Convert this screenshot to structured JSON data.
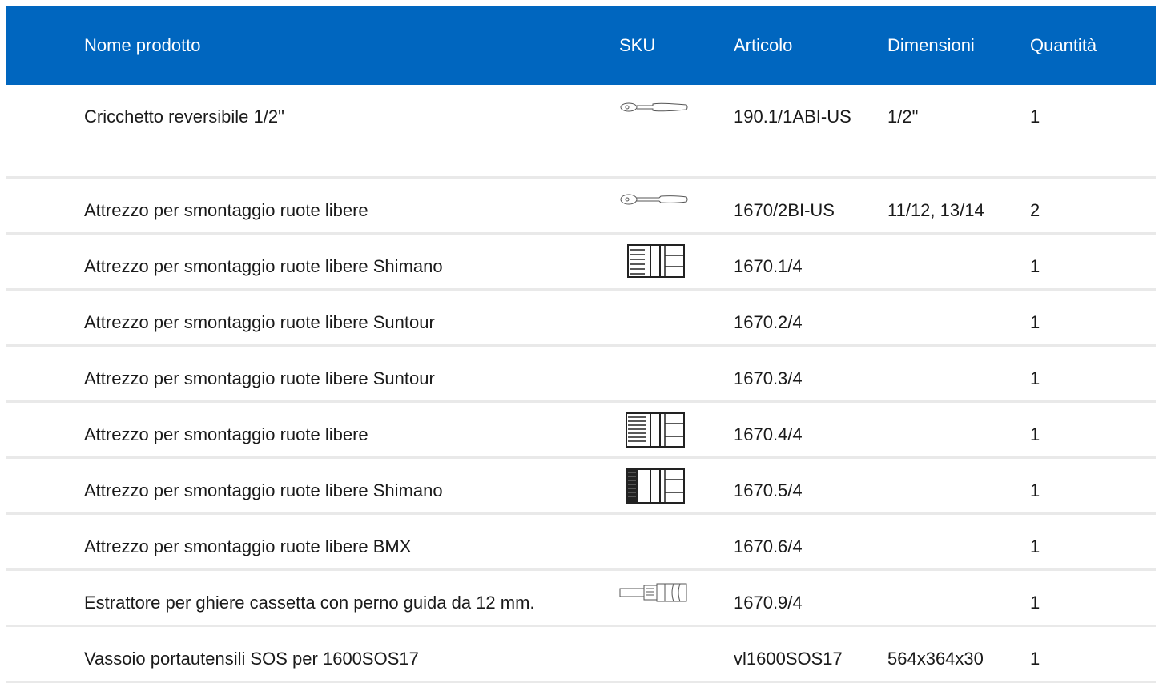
{
  "table": {
    "headers": {
      "name": "Nome prodotto",
      "sku": "SKU",
      "article": "Articolo",
      "dimensions": "Dimensioni",
      "quantity": "Quantità"
    },
    "rows": [
      {
        "name": "Cricchetto reversibile 1/2\"",
        "sku_icon": "ratchet-icon",
        "article": "190.1/1ABI-US",
        "dimensions": "1/2\"",
        "quantity": "1"
      },
      {
        "name": "Attrezzo per smontaggio ruote libere",
        "sku_icon": "ratchet-small-icon",
        "article": "1670/2BI-US",
        "dimensions": "11/12, 13/14",
        "quantity": "2"
      },
      {
        "name": "Attrezzo per smontaggio ruote libere Shimano",
        "sku_icon": "splined-socket-icon",
        "article": "1670.1/4",
        "dimensions": "",
        "quantity": "1"
      },
      {
        "name": "Attrezzo per smontaggio ruote libere Suntour",
        "sku_icon": "",
        "article": "1670.2/4",
        "dimensions": "",
        "quantity": "1"
      },
      {
        "name": "Attrezzo per smontaggio ruote libere Suntour",
        "sku_icon": "",
        "article": "1670.3/4",
        "dimensions": "",
        "quantity": "1"
      },
      {
        "name": "Attrezzo per smontaggio ruote libere",
        "sku_icon": "splined-socket-icon",
        "article": "1670.4/4",
        "dimensions": "",
        "quantity": "1"
      },
      {
        "name": "Attrezzo per smontaggio ruote libere Shimano",
        "sku_icon": "splined-socket-dark-icon",
        "article": "1670.5/4",
        "dimensions": "",
        "quantity": "1"
      },
      {
        "name": "Attrezzo per smontaggio ruote libere BMX",
        "sku_icon": "",
        "article": "1670.6/4",
        "dimensions": "",
        "quantity": "1"
      },
      {
        "name": "Estrattore per ghiere cassetta con perno guida da 12 mm.",
        "sku_icon": "cassette-extractor-icon",
        "article": "1670.9/4",
        "dimensions": "",
        "quantity": "1"
      },
      {
        "name": "Vassoio portautensili SOS per 1600SOS17",
        "sku_icon": "",
        "article": "vl1600SOS17",
        "dimensions": "564x364x30",
        "quantity": "1"
      }
    ]
  }
}
